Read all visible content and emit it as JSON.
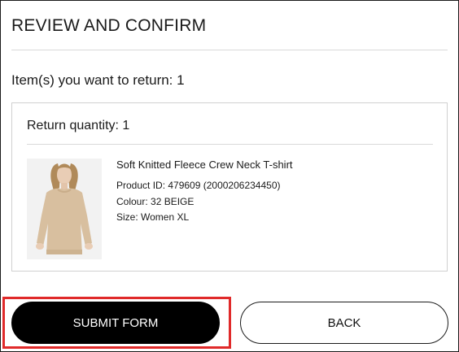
{
  "dialog": {
    "title": "REVIEW AND CONFIRM",
    "items_line": "Item(s) you want to return: 1"
  },
  "card": {
    "return_quantity": "Return quantity: 1",
    "product": {
      "name": "Soft Knitted Fleece Crew Neck T-shirt",
      "product_id": "Product ID: 479609 (2000206234450)",
      "colour": "Colour: 32 BEIGE",
      "size": "Size: Women XL",
      "image_icon": "product-photo"
    }
  },
  "actions": {
    "submit_label": "SUBMIT FORM",
    "back_label": "BACK"
  },
  "colors": {
    "primary_button": "#000000",
    "highlight": "#e02a2a",
    "sweater": "#d8bf9f"
  }
}
